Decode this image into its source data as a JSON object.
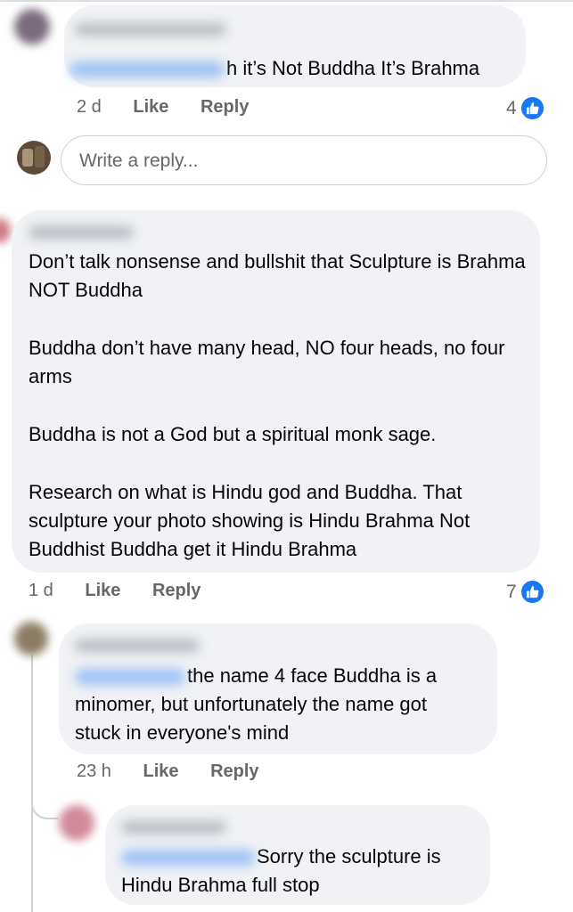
{
  "comments": [
    {
      "id": "c1",
      "text_after_mention": "h it’s Not Buddha It’s Brahma",
      "time": "2 d",
      "like_label": "Like",
      "reply_label": "Reply",
      "reaction_count": "4"
    },
    {
      "id": "c2",
      "paragraphs": [
        "Don’t talk nonsense and bullshit that Sculpture is Brahma NOT Buddha",
        "Buddha don’t have many head, NO four heads, no four arms",
        "Buddha is not a God but a spiritual monk sage.",
        "Research on what is Hindu god and Buddha. That sculpture your photo showing is Hindu Brahma Not Buddhist Buddha get it Hindu Brahma"
      ],
      "time": "1 d",
      "like_label": "Like",
      "reply_label": "Reply",
      "reaction_count": "7"
    },
    {
      "id": "c3",
      "line1_after_mention": "the name 4 face Buddha is a",
      "line2": "minomer, but unfortunately the name got",
      "line3": "stuck in everyone's mind",
      "time": "23 h",
      "like_label": "Like",
      "reply_label": "Reply"
    },
    {
      "id": "c4",
      "line1_after_mention": "Sorry the sculpture is",
      "line2": "Hindu Brahma full stop"
    }
  ],
  "reply_box": {
    "placeholder": "Write a reply..."
  },
  "colors": {
    "bubble": "#f0f2f5",
    "meta": "#65676b",
    "like_blue": "#1877f2"
  }
}
